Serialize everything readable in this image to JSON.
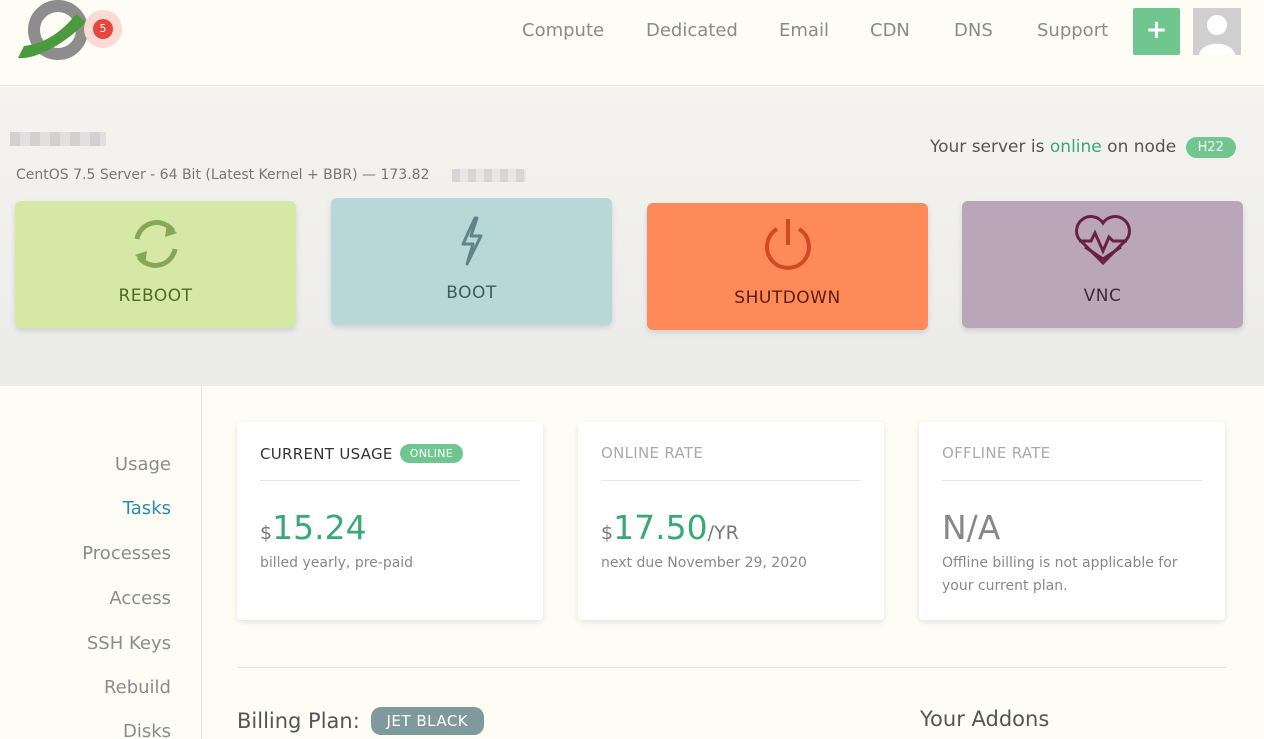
{
  "header": {
    "notification_count": "5",
    "nav": [
      "Compute",
      "Dedicated",
      "Email",
      "CDN",
      "DNS",
      "Support"
    ],
    "add_label": "+"
  },
  "server": {
    "subtitle": "CentOS 7.5 Server - 64 Bit (Latest Kernel + BBR) — 173.82",
    "status_prefix": "Your server is",
    "status_word": "online",
    "status_mid": "on node",
    "node": "H22"
  },
  "actions": [
    {
      "label": "REBOOT",
      "icon": "reboot-icon"
    },
    {
      "label": "BOOT",
      "icon": "bolt-icon"
    },
    {
      "label": "SHUTDOWN",
      "icon": "power-icon"
    },
    {
      "label": "VNC",
      "icon": "heart-monitor-icon"
    }
  ],
  "sidebar": {
    "items": [
      "Usage",
      "Tasks",
      "Processes",
      "Access",
      "SSH Keys",
      "Rebuild",
      "Disks"
    ],
    "active": "Tasks"
  },
  "cards": {
    "current": {
      "title": "CURRENT USAGE",
      "badge": "ONLINE",
      "currency": "$",
      "amount": "15.24",
      "note": "billed yearly, pre-paid"
    },
    "online_rate": {
      "title": "ONLINE RATE",
      "currency": "$",
      "amount": "17.50",
      "unit": "/YR",
      "note": "next due November 29, 2020"
    },
    "offline_rate": {
      "title": "OFFLINE RATE",
      "amount": "N/A",
      "note": "Offline billing is not applicable for your current plan."
    }
  },
  "billing": {
    "label": "Billing Plan:",
    "plan": "JET BLACK",
    "addons_label": "Your Addons"
  },
  "colors": {
    "accent_green": "#6fc68f",
    "online_green": "#3aa874",
    "active_blue": "#2a8bb0",
    "reboot": "#d6e8a6",
    "boot": "#b8d8d7",
    "shutdown": "#fe8a5a",
    "vnc": "#b9a6b8"
  }
}
